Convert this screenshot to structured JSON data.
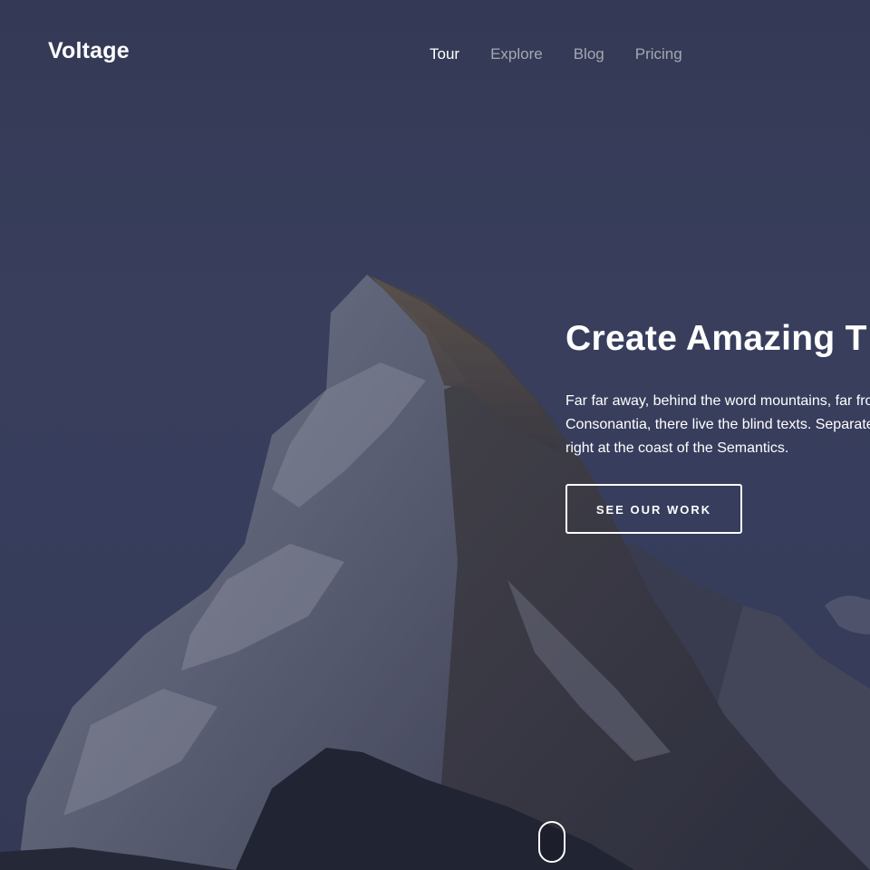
{
  "brand": "Voltage",
  "nav": {
    "items": [
      {
        "label": "Tour",
        "active": true
      },
      {
        "label": "Explore",
        "active": false
      },
      {
        "label": "Blog",
        "active": false
      },
      {
        "label": "Pricing",
        "active": false
      }
    ]
  },
  "hero": {
    "title": "Create Amazing T",
    "description_lines": [
      "Far far away, behind the word mountains, far fro",
      "Consonantia, there live the blind texts. Separate",
      "right at the coast of the Semantics."
    ],
    "cta_label": "SEE OUR WORK"
  },
  "colors": {
    "overlay": "#363c58",
    "text": "#ffffff",
    "nav_inactive": "rgba(255,255,255,0.55)"
  },
  "icons": {
    "scroll": "mouse-scroll-icon"
  }
}
